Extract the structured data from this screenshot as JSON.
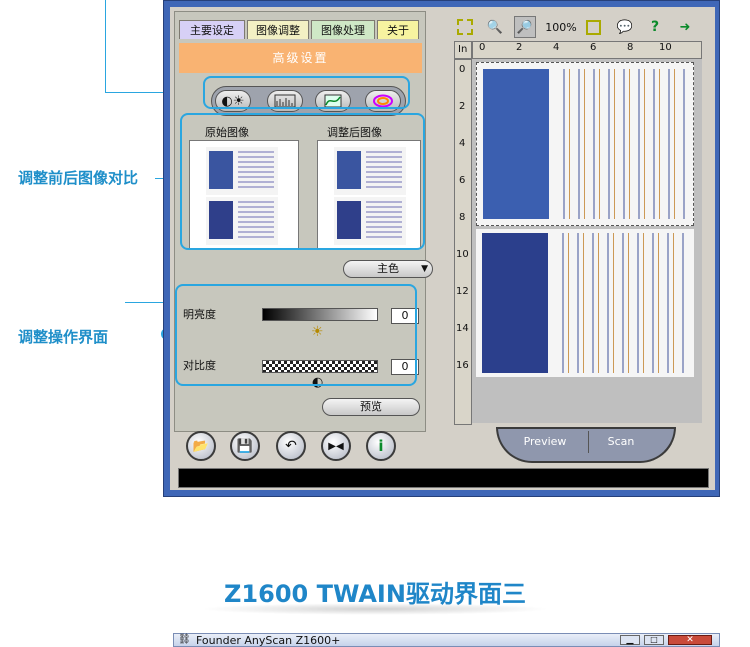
{
  "annotations": {
    "compare": "调整前后图像对比",
    "ui": "调整操作界面"
  },
  "tabs": [
    "主要设定",
    "图像调整",
    "图像处理",
    "关于"
  ],
  "panel_title": "高级设置",
  "image_labels": {
    "original": "原始图像",
    "adjusted": "调整后图像"
  },
  "channel_select": "主色",
  "brightness": {
    "label": "明亮度",
    "value": "0"
  },
  "contrast": {
    "label": "对比度",
    "value": "0"
  },
  "preview_label": "预览",
  "toolbar": {
    "zoom": "100%"
  },
  "ruler": {
    "unit": "In",
    "top": [
      "0",
      "2",
      "4",
      "6",
      "8",
      "10"
    ],
    "left": [
      "0",
      "2",
      "4",
      "6",
      "8",
      "10",
      "12",
      "14",
      "16"
    ]
  },
  "buttons": {
    "preview": "Preview",
    "scan": "Scan"
  },
  "page_title": "Z1600 TWAIN驱动界面三",
  "second_window_title": "Founder AnyScan Z1600+",
  "colors": {
    "accent": "#2aa6e0",
    "window_frame": "#3f67b7",
    "panel_header": "#f9b372"
  }
}
